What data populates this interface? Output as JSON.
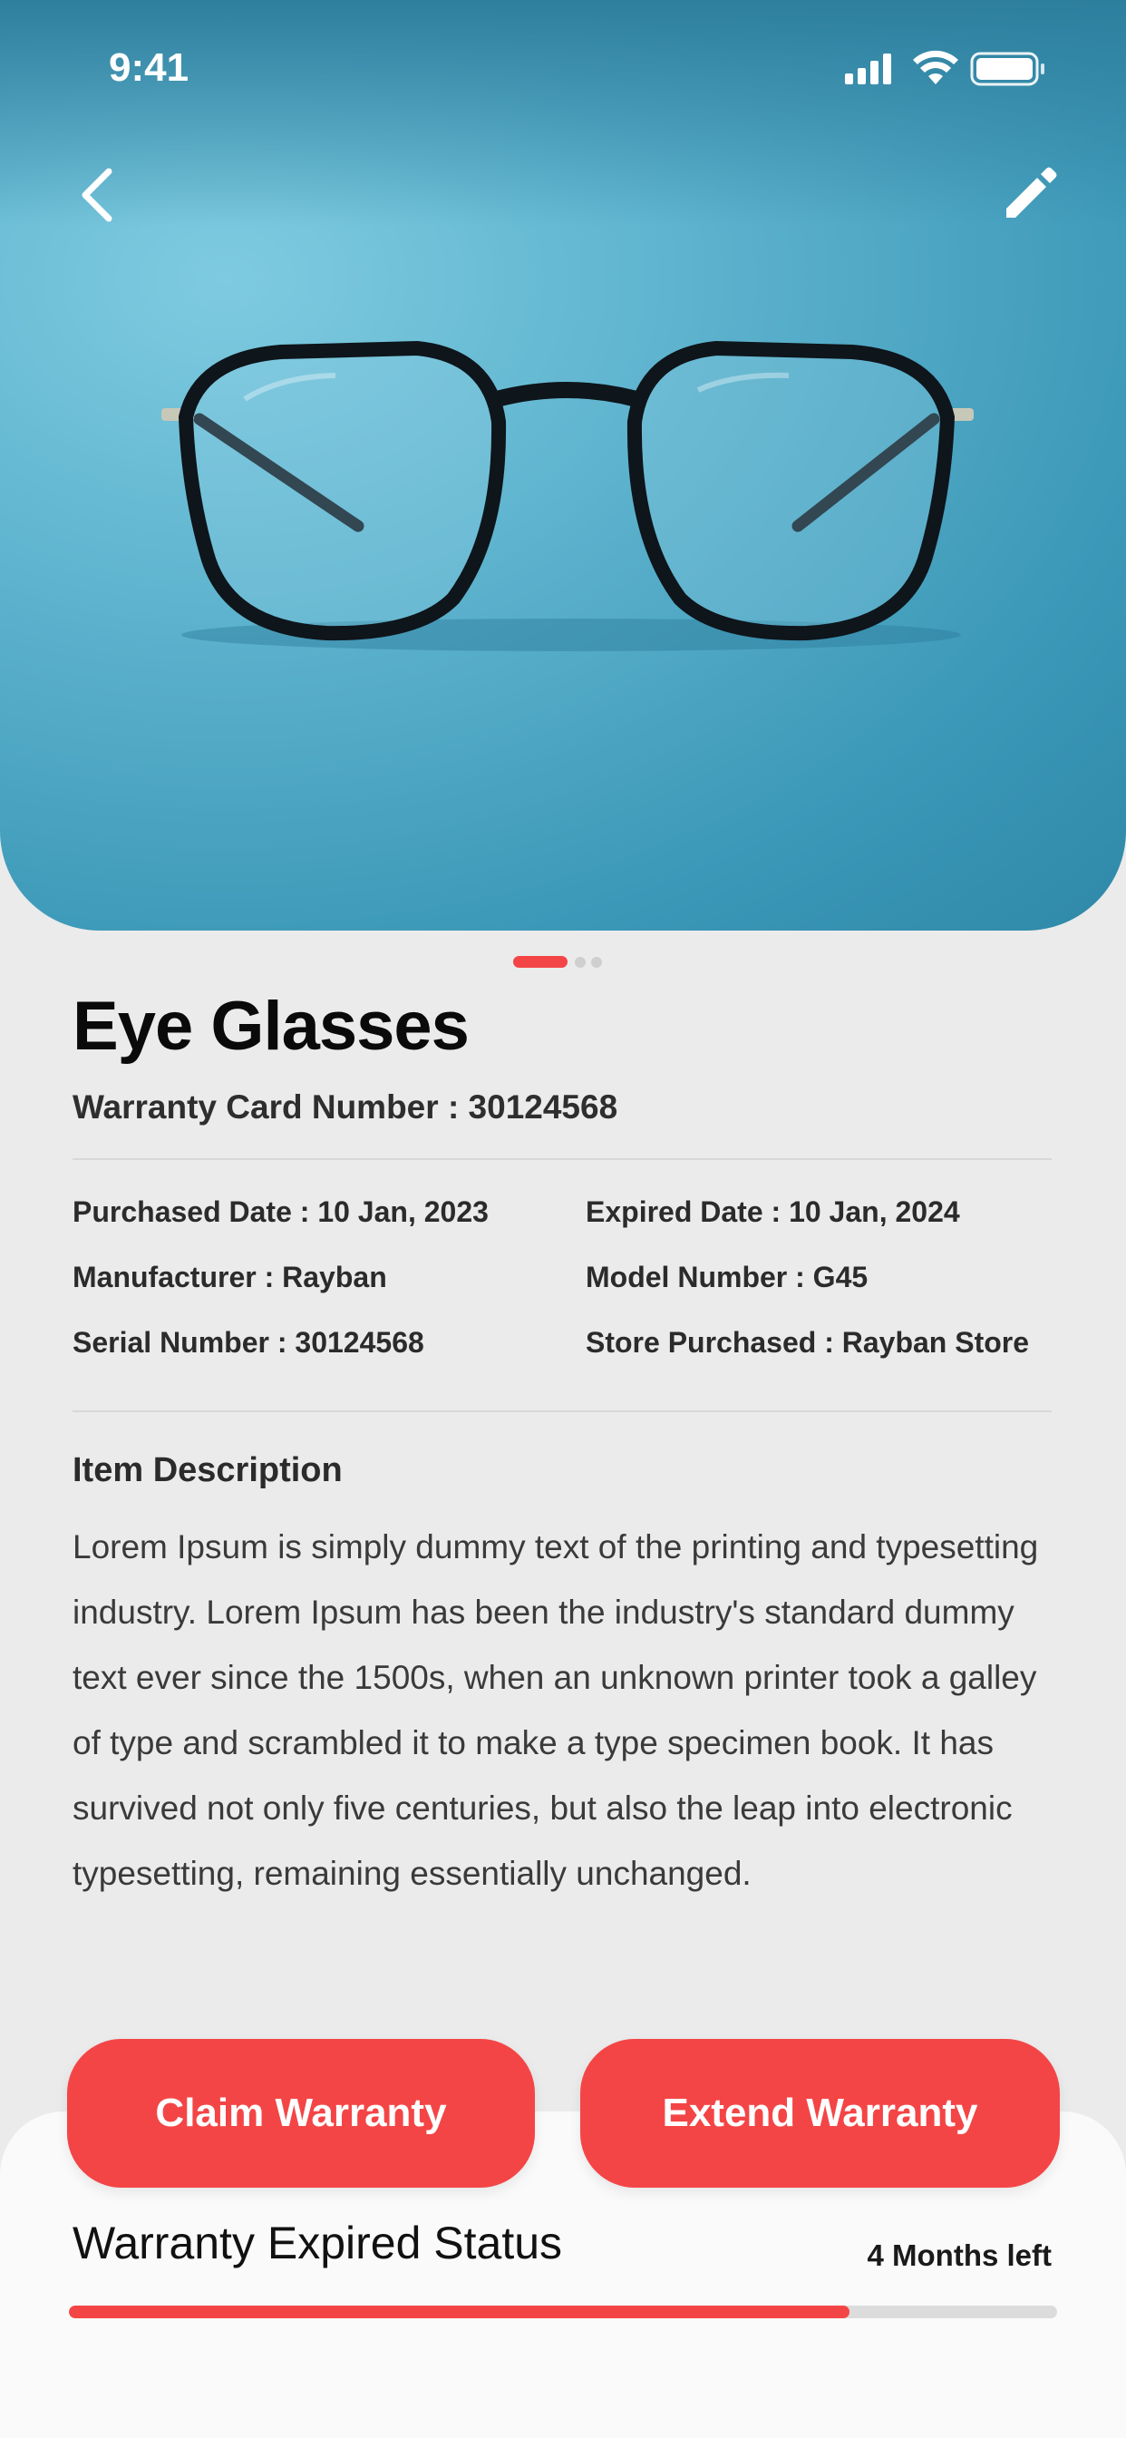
{
  "status_bar": {
    "time": "9:41"
  },
  "hero": {
    "icons": [
      "back-chevron-icon",
      "edit-pencil-icon"
    ],
    "image": "eyeglasses-photo"
  },
  "carousel": {
    "pages": 3,
    "active": 0
  },
  "item": {
    "title": "Eye Glasses",
    "warranty_card": "Warranty Card Number : 30124568",
    "details": {
      "purchased": "Purchased Date : 10 Jan, 2023",
      "expired": "Expired Date : 10 Jan, 2024",
      "manufacturer": "Manufacturer : Rayban",
      "model": "Model Number : G45",
      "serial": "Serial Number : 30124568",
      "store": "Store Purchased : Rayban Store"
    },
    "description_heading": "Item Description",
    "description": "Lorem Ipsum is simply dummy text of the printing and typesetting industry. Lorem Ipsum has been the industry's standard dummy text ever since the 1500s, when an unknown printer took a galley of type and scrambled it to make a type specimen book. It has survived not only five centuries, but also the leap into electronic typesetting, remaining essentially unchanged."
  },
  "actions": {
    "claim": "Claim Warranty",
    "extend": "Extend Warranty"
  },
  "warranty_status": {
    "title": "Warranty Expired Status",
    "remaining": "4 Months left",
    "progress_fraction": 0.79
  },
  "colors": {
    "accent": "#f44546",
    "hero_bg": "#5fb4cf",
    "page_bg": "#ebebeb"
  }
}
